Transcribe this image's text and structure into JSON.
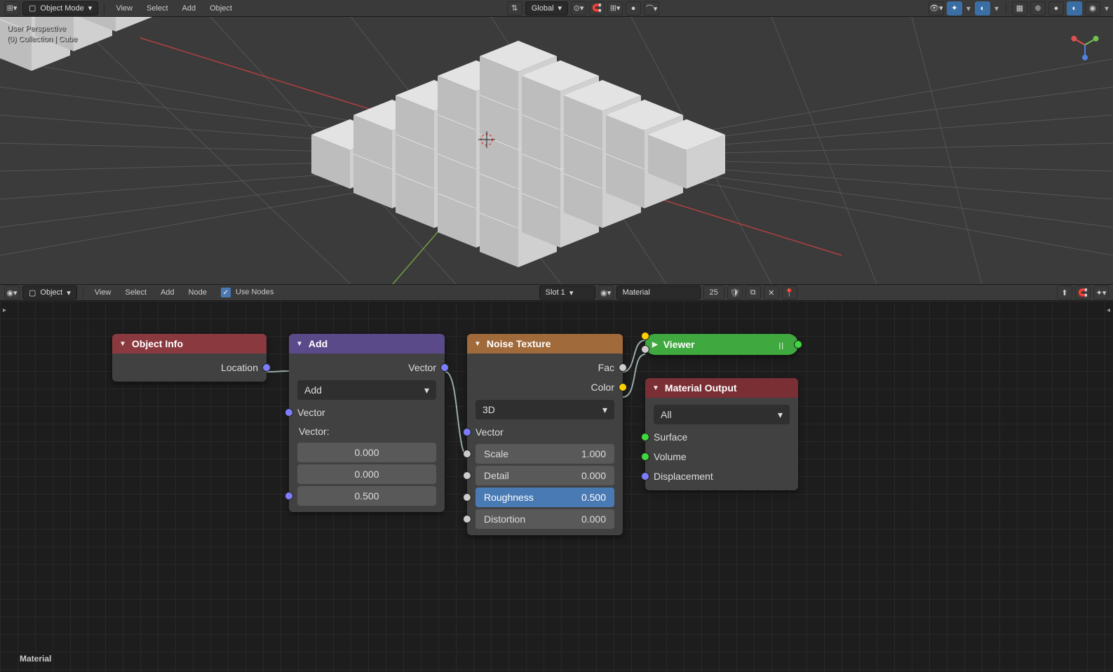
{
  "header_top": {
    "mode": "Object Mode",
    "menus": [
      "View",
      "Select",
      "Add",
      "Object"
    ],
    "orient": "Global"
  },
  "viewport": {
    "overlay_line1": "User Perspective",
    "overlay_line2": "(0) Collection | Cube"
  },
  "header_node": {
    "type": "Object",
    "menus": [
      "View",
      "Select",
      "Add",
      "Node"
    ],
    "use_nodes": "Use Nodes",
    "slot": "Slot 1",
    "material": "Material",
    "users": "25"
  },
  "nodes": {
    "object_info": {
      "title": "Object Info",
      "out1": "Location"
    },
    "add": {
      "title": "Add",
      "out1": "Vector",
      "mode": "Add",
      "in1": "Vector",
      "in2_label": "Vector:",
      "v0": "0.000",
      "v1": "0.000",
      "v2": "0.500"
    },
    "noise": {
      "title": "Noise Texture",
      "out1": "Fac",
      "out2": "Color",
      "dim": "3D",
      "in_vec": "Vector",
      "scale_l": "Scale",
      "scale_v": "1.000",
      "detail_l": "Detail",
      "detail_v": "0.000",
      "rough_l": "Roughness",
      "rough_v": "0.500",
      "dist_l": "Distortion",
      "dist_v": "0.000"
    },
    "viewer": {
      "title": "Viewer"
    },
    "matout": {
      "title": "Material Output",
      "target": "All",
      "in1": "Surface",
      "in2": "Volume",
      "in3": "Displacement"
    }
  },
  "footer": {
    "label": "Material"
  }
}
